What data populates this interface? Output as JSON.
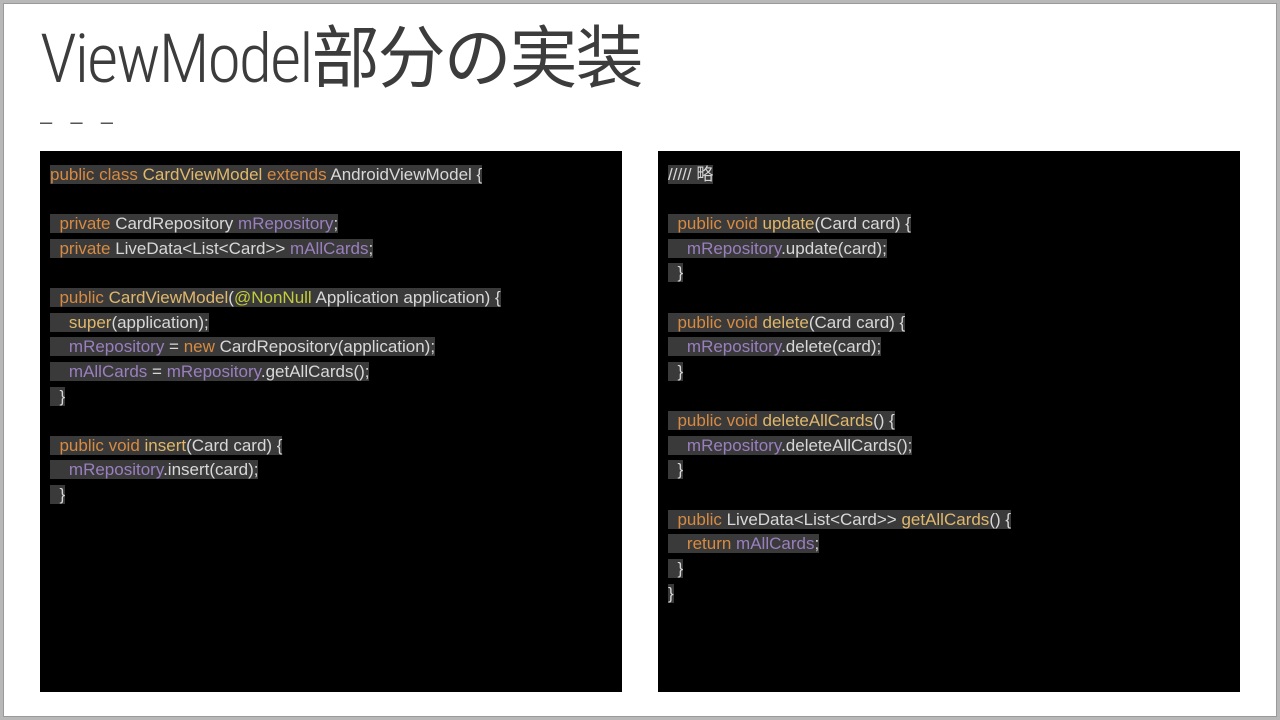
{
  "title": "ViewModel部分の実装",
  "dashes": "– – –",
  "code_left": {
    "lines": [
      [
        [
          "kw",
          "public class "
        ],
        [
          "meth",
          "CardViewModel "
        ],
        [
          "kw",
          "extends "
        ],
        [
          "type",
          "AndroidViewModel {"
        ]
      ],
      [],
      [
        [
          "pun",
          "  "
        ],
        [
          "kw",
          "private "
        ],
        [
          "type",
          "CardRepository "
        ],
        [
          "mem",
          "mRepository"
        ],
        [
          "pun",
          ";"
        ]
      ],
      [
        [
          "pun",
          "  "
        ],
        [
          "kw",
          "private "
        ],
        [
          "type",
          "LiveData<List<Card>> "
        ],
        [
          "mem",
          "mAllCards"
        ],
        [
          "pun",
          ";"
        ]
      ],
      [],
      [
        [
          "pun",
          "  "
        ],
        [
          "kw",
          "public "
        ],
        [
          "meth",
          "CardViewModel"
        ],
        [
          "pun",
          "("
        ],
        [
          "anno",
          "@NonNull "
        ],
        [
          "type",
          "Application "
        ],
        [
          "par",
          "application"
        ],
        [
          "pun",
          ") {"
        ]
      ],
      [
        [
          "pun",
          "    "
        ],
        [
          "meth",
          "super"
        ],
        [
          "pun",
          "(application);"
        ]
      ],
      [
        [
          "pun",
          "    "
        ],
        [
          "mem",
          "mRepository"
        ],
        [
          "pun",
          " = "
        ],
        [
          "kw",
          "new "
        ],
        [
          "type",
          "CardRepository"
        ],
        [
          "pun",
          "(application);"
        ]
      ],
      [
        [
          "pun",
          "    "
        ],
        [
          "mem",
          "mAllCards"
        ],
        [
          "pun",
          " = "
        ],
        [
          "mem",
          "mRepository"
        ],
        [
          "pun",
          ".getAllCards();"
        ]
      ],
      [
        [
          "pun",
          "  }"
        ]
      ],
      [],
      [
        [
          "pun",
          "  "
        ],
        [
          "kw",
          "public void "
        ],
        [
          "meth",
          "insert"
        ],
        [
          "pun",
          "(Card card) {"
        ]
      ],
      [
        [
          "pun",
          "    "
        ],
        [
          "mem",
          "mRepository"
        ],
        [
          "pun",
          ".insert(card);"
        ]
      ],
      [
        [
          "pun",
          "  }"
        ]
      ]
    ]
  },
  "code_right": {
    "lines": [
      [
        [
          "pun",
          "///// 略"
        ]
      ],
      [],
      [
        [
          "pun",
          "  "
        ],
        [
          "kw",
          "public void "
        ],
        [
          "meth",
          "update"
        ],
        [
          "pun",
          "(Card card) {"
        ]
      ],
      [
        [
          "pun",
          "    "
        ],
        [
          "mem",
          "mRepository"
        ],
        [
          "pun",
          ".update(card);"
        ]
      ],
      [
        [
          "pun",
          "  }"
        ]
      ],
      [],
      [
        [
          "pun",
          "  "
        ],
        [
          "kw",
          "public void "
        ],
        [
          "meth",
          "delete"
        ],
        [
          "pun",
          "(Card card) {"
        ]
      ],
      [
        [
          "pun",
          "    "
        ],
        [
          "mem",
          "mRepository"
        ],
        [
          "pun",
          ".delete(card);"
        ]
      ],
      [
        [
          "pun",
          "  }"
        ]
      ],
      [],
      [
        [
          "pun",
          "  "
        ],
        [
          "kw",
          "public void "
        ],
        [
          "meth",
          "deleteAllCards"
        ],
        [
          "pun",
          "() {"
        ]
      ],
      [
        [
          "pun",
          "    "
        ],
        [
          "mem",
          "mRepository"
        ],
        [
          "pun",
          ".deleteAllCards();"
        ]
      ],
      [
        [
          "pun",
          "  }"
        ]
      ],
      [],
      [
        [
          "pun",
          "  "
        ],
        [
          "kw",
          "public "
        ],
        [
          "type",
          "LiveData<List<Card>> "
        ],
        [
          "meth",
          "getAllCards"
        ],
        [
          "pun",
          "() {"
        ]
      ],
      [
        [
          "pun",
          "    "
        ],
        [
          "kw",
          "return "
        ],
        [
          "mem",
          "mAllCards"
        ],
        [
          "pun",
          ";"
        ]
      ],
      [
        [
          "pun",
          "  }"
        ]
      ],
      [
        [
          "pun",
          "}"
        ]
      ]
    ]
  }
}
